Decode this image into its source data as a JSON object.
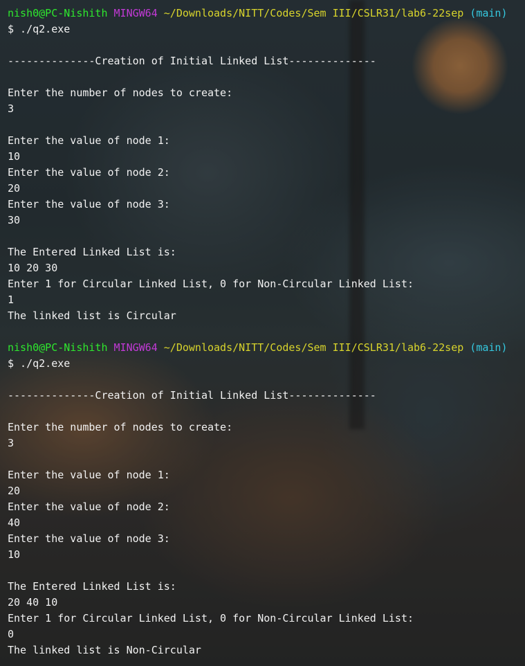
{
  "prompt": {
    "user_host": "nish0@PC-Nishith",
    "system": "MINGW64",
    "path": "~/Downloads/NITT/Codes/Sem III/CSLR31/lab6-22sep",
    "branch": "(main)",
    "command": "$ ./q2.exe"
  },
  "session1": {
    "header": "--------------Creation of Initial Linked List--------------",
    "ask_nodes": "Enter the number of nodes to create:",
    "nodes": "3",
    "ask_node1": "Enter the value of node 1:",
    "val1": "10",
    "ask_node2": "Enter the value of node 2:",
    "val2": "20",
    "ask_node3": "Enter the value of node 3:",
    "val3": "30",
    "entered_label": "The Entered Linked List is:",
    "list": "10 20 30",
    "ask_circular": "Enter 1 for Circular Linked List, 0 for Non-Circular Linked List:",
    "choice": "1",
    "result": "The linked list is Circular"
  },
  "session2": {
    "header": "--------------Creation of Initial Linked List--------------",
    "ask_nodes": "Enter the number of nodes to create:",
    "nodes": "3",
    "ask_node1": "Enter the value of node 1:",
    "val1": "20",
    "ask_node2": "Enter the value of node 2:",
    "val2": "40",
    "ask_node3": "Enter the value of node 3:",
    "val3": "10",
    "entered_label": "The Entered Linked List is:",
    "list": "20 40 10",
    "ask_circular": "Enter 1 for Circular Linked List, 0 for Non-Circular Linked List:",
    "choice": "0",
    "result": "The linked list is Non-Circular"
  },
  "colors": {
    "user_host": "#2ee82e",
    "system": "#c23ad6",
    "path": "#d8d42c",
    "branch": "#35c9e0",
    "text": "#f2f2f2"
  }
}
